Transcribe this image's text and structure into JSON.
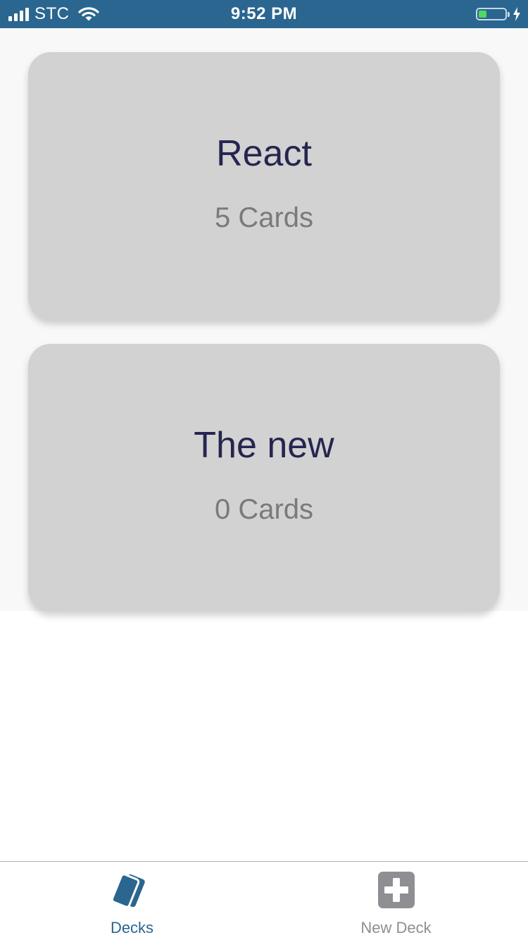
{
  "status_bar": {
    "carrier": "STC",
    "time": "9:52 PM",
    "battery_level": 0.3
  },
  "decks": [
    {
      "title": "React",
      "count_label": "5 Cards"
    },
    {
      "title": "The new",
      "count_label": "0 Cards"
    }
  ],
  "tab_bar": {
    "tabs": [
      {
        "label": "Decks",
        "icon": "cards-icon",
        "active": true
      },
      {
        "label": "New Deck",
        "icon": "plus-square-icon",
        "active": false
      }
    ]
  },
  "colors": {
    "status_bar_bg": "#2a6690",
    "tab_active": "#2a6690",
    "tab_inactive": "#8e8e93",
    "deck_card_bg": "#d2d2d2",
    "deck_title": "#252550",
    "deck_count": "#7a7a7a"
  }
}
